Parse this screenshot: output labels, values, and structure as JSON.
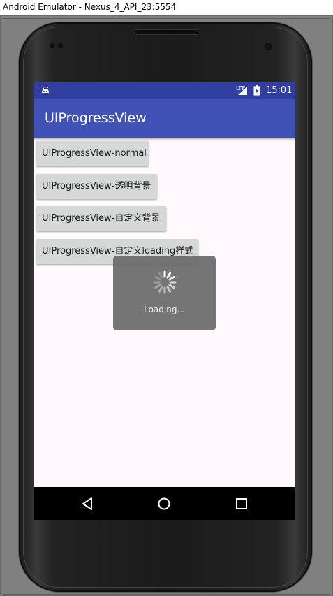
{
  "window": {
    "title": "Android Emulator - Nexus_4_API_23:5554"
  },
  "statusbar": {
    "network_label": "LTE",
    "time": "15:01",
    "icons": [
      "android-icon",
      "signal-icon",
      "battery-icon"
    ]
  },
  "appbar": {
    "title": "UIProgressView"
  },
  "buttons": [
    {
      "label": "UIProgressView-normal"
    },
    {
      "label": "UIProgressView-透明背景"
    },
    {
      "label": "UIProgressView-自定义背景"
    },
    {
      "label": "UIProgressView-自定义loading样式"
    }
  ],
  "loading": {
    "text": "Loading..."
  },
  "navbar": {
    "icons": [
      "back-icon",
      "home-icon",
      "recents-icon"
    ]
  },
  "colors": {
    "statusbar": "#303f9f",
    "appbar": "#3f51b5",
    "button": "#d6d7d7",
    "dialog": "#696969"
  }
}
